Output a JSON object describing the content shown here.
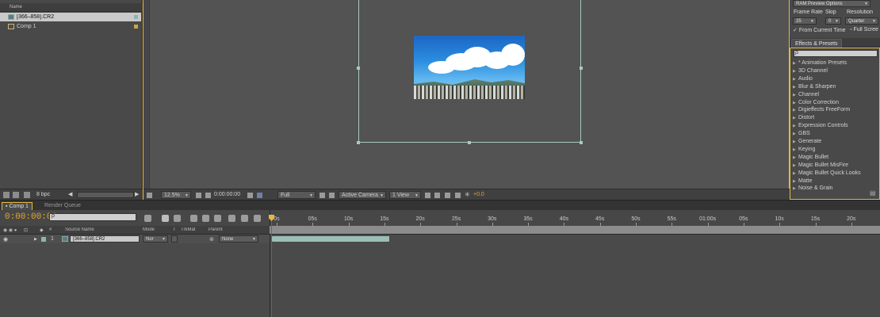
{
  "project": {
    "column_name": "Name",
    "items": [
      {
        "name": "[366–858].CR2",
        "icon": "footage-icon",
        "selected": true
      },
      {
        "name": "Comp 1",
        "icon": "composition-icon",
        "selected": false
      }
    ],
    "footer": {
      "bpc": "8 bpc"
    }
  },
  "viewer": {
    "magnification": "12.5%",
    "timecode": "0:00:00:00",
    "resolution": "Full",
    "camera": "Active Camera",
    "views": "1 View",
    "exposure": "+0.0"
  },
  "preview": {
    "title": "RAM Preview Options",
    "frame_rate_label": "Frame Rate",
    "skip_label": "Skip",
    "resolution_label": "Resolution",
    "frame_rate_value": "25",
    "skip_value": "0",
    "resolution_value": "Quarter",
    "from_current_time": "From Current Time",
    "full_screen": "Full Scree"
  },
  "effects": {
    "tab": "Effects & Presets",
    "search_placeholder": "ρ",
    "items": [
      "* Animation Presets",
      "3D Channel",
      "Audio",
      "Blur & Sharpen",
      "Channel",
      "Color Correction",
      "Digieffects FreeForm",
      "Distort",
      "Expression Controls",
      "GBS",
      "Generate",
      "Keying",
      "Magic Bullet",
      "Magic Bullet MisFire",
      "Magic Bullet Quick Looks",
      "Matte",
      "Noise & Grain"
    ]
  },
  "timeline": {
    "tabs": [
      "Comp 1",
      "Render Queue"
    ],
    "timecode": "0:00:00:00",
    "search_placeholder": "ρ",
    "columns": {
      "number": "#",
      "source_name": "Source Name",
      "mode": "Mode",
      "t": "T",
      "trkmat": "TrkMat",
      "parent": "Parent"
    },
    "layer": {
      "number": "1",
      "name": "[366–858].CR2",
      "mode": "Nor",
      "parent": "None"
    },
    "ruler": [
      "0s",
      "05s",
      "10s",
      "15s",
      "20s",
      "25s",
      "30s",
      "35s",
      "40s",
      "45s",
      "50s",
      "55s",
      "01:00s",
      "05s",
      "10s",
      "15s",
      "20s"
    ]
  },
  "colors": {
    "accent": "#e5b93c",
    "timecode": "#e6a72a",
    "cti": "#c83a2a",
    "layer_bar": "#9bbfb7"
  }
}
